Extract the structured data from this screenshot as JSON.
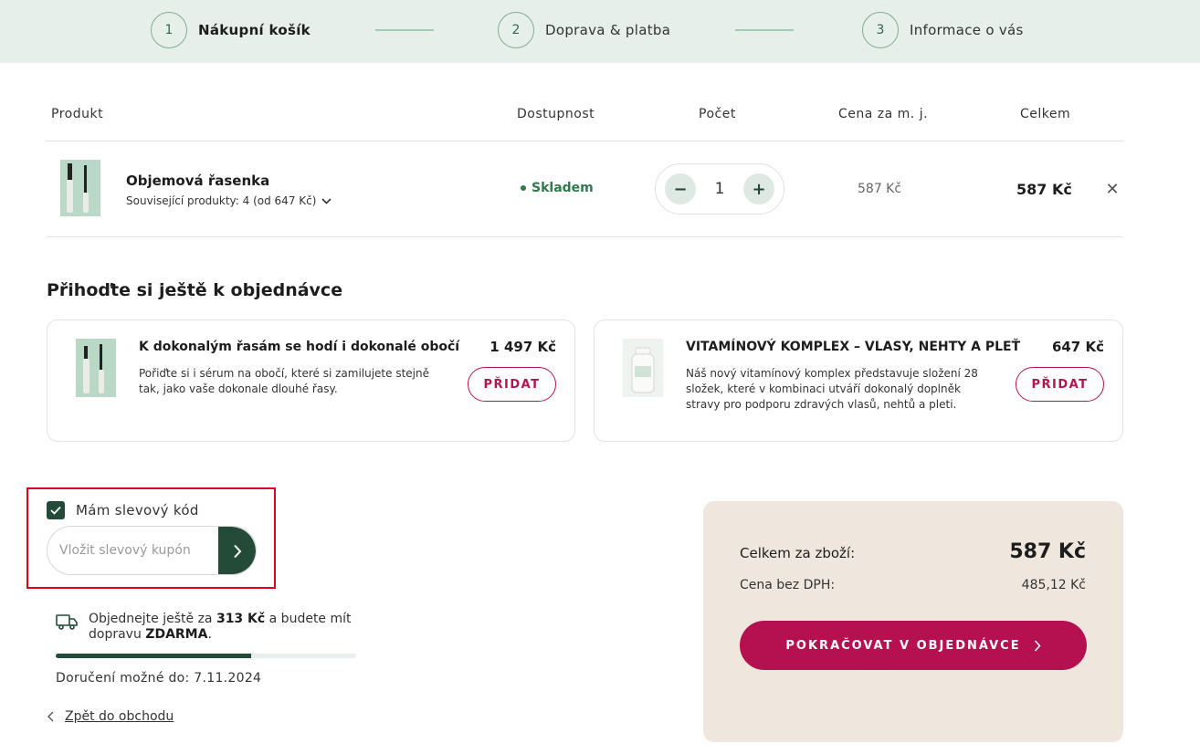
{
  "stepper": {
    "steps": [
      {
        "num": "1",
        "label": "Nákupní košík"
      },
      {
        "num": "2",
        "label": "Doprava & platba"
      },
      {
        "num": "3",
        "label": "Informace o vás"
      }
    ]
  },
  "table": {
    "headers": {
      "product": "Produkt",
      "availability": "Dostupnost",
      "qty": "Počet",
      "unit_price": "Cena za m. j.",
      "total": "Celkem"
    },
    "row": {
      "name": "Objemová řasenka",
      "related": "Související produkty: 4 (od 647 Kč)",
      "stock": "Skladem",
      "qty": "1",
      "qty_minus": "−",
      "qty_plus": "+",
      "unit_price": "587 Kč",
      "total": "587 Kč",
      "remove": "✕"
    }
  },
  "upsell": {
    "title": "Přihoďte si ještě k objednávce",
    "items": [
      {
        "title": "K dokonalým řasám se hodí i dokonalé obočí",
        "desc": "Pořiďte si i sérum na obočí, které si zamilujete stejně tak, jako vaše dokonale dlouhé řasy.",
        "price": "1 497 Kč",
        "button": "PŘIDAT"
      },
      {
        "title": "VITAMÍNOVÝ KOMPLEX – VLASY, NEHTY A PLEŤ",
        "desc": "Náš nový vitamínový komplex představuje složení 28 složek, které v kombinaci utváří dokonalý doplněk stravy pro podporu zdravých vlasů, nehtů a pleti.",
        "price": "647 Kč",
        "button": "PŘIDAT"
      }
    ]
  },
  "discount": {
    "checkbox_label": "Mám slevový kód",
    "checked": true,
    "placeholder": "Vložit slevový kupón",
    "value": ""
  },
  "shipping": {
    "text_before": "Objednejte ještě za ",
    "amount": "313 Kč",
    "text_middle": " a budete mít dopravu ",
    "free": "ZDARMA",
    "text_after": ".",
    "progress_percent": 65,
    "delivery": "Doručení možné do: 7.11.2024"
  },
  "back_link": "Zpět do obchodu",
  "summary": {
    "goods_label": "Celkem za zboží:",
    "goods_value": "587 Kč",
    "vat_label": "Cena bez DPH:",
    "vat_value": "485,12 Kč",
    "cta": "POKRAČOVAT V OBJEDNÁVCE"
  },
  "colors": {
    "accent_green": "#234b37",
    "accent_pink": "#b5104f",
    "stepper_bg": "#e6efea",
    "summary_bg": "#efe7de"
  }
}
